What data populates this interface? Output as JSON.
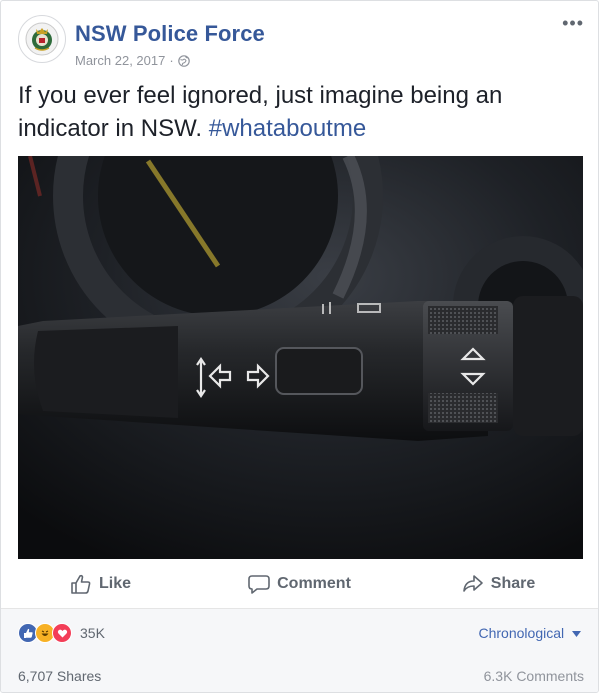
{
  "post": {
    "page_name": "NSW Police Force",
    "date": "March 22, 2017",
    "separator": "·",
    "more_label": "•••",
    "text": "If you ever feel ignored, just imagine being an indicator in NSW.",
    "hashtag": "#whataboutme",
    "image_alt": "car indicator stalk close-up"
  },
  "actions": {
    "like": "Like",
    "comment": "Comment",
    "share": "Share"
  },
  "reactions": {
    "icons": [
      "like-icon",
      "haha-icon",
      "love-icon"
    ],
    "count": "35K",
    "sort_label": "Chronological"
  },
  "stats": {
    "shares": "6,707 Shares",
    "comments": "6.3K Comments"
  },
  "colors": {
    "brand": "#365899",
    "like": "#4267b2",
    "love": "#f33e58",
    "haha": "#f7b125",
    "muted": "#606770"
  }
}
